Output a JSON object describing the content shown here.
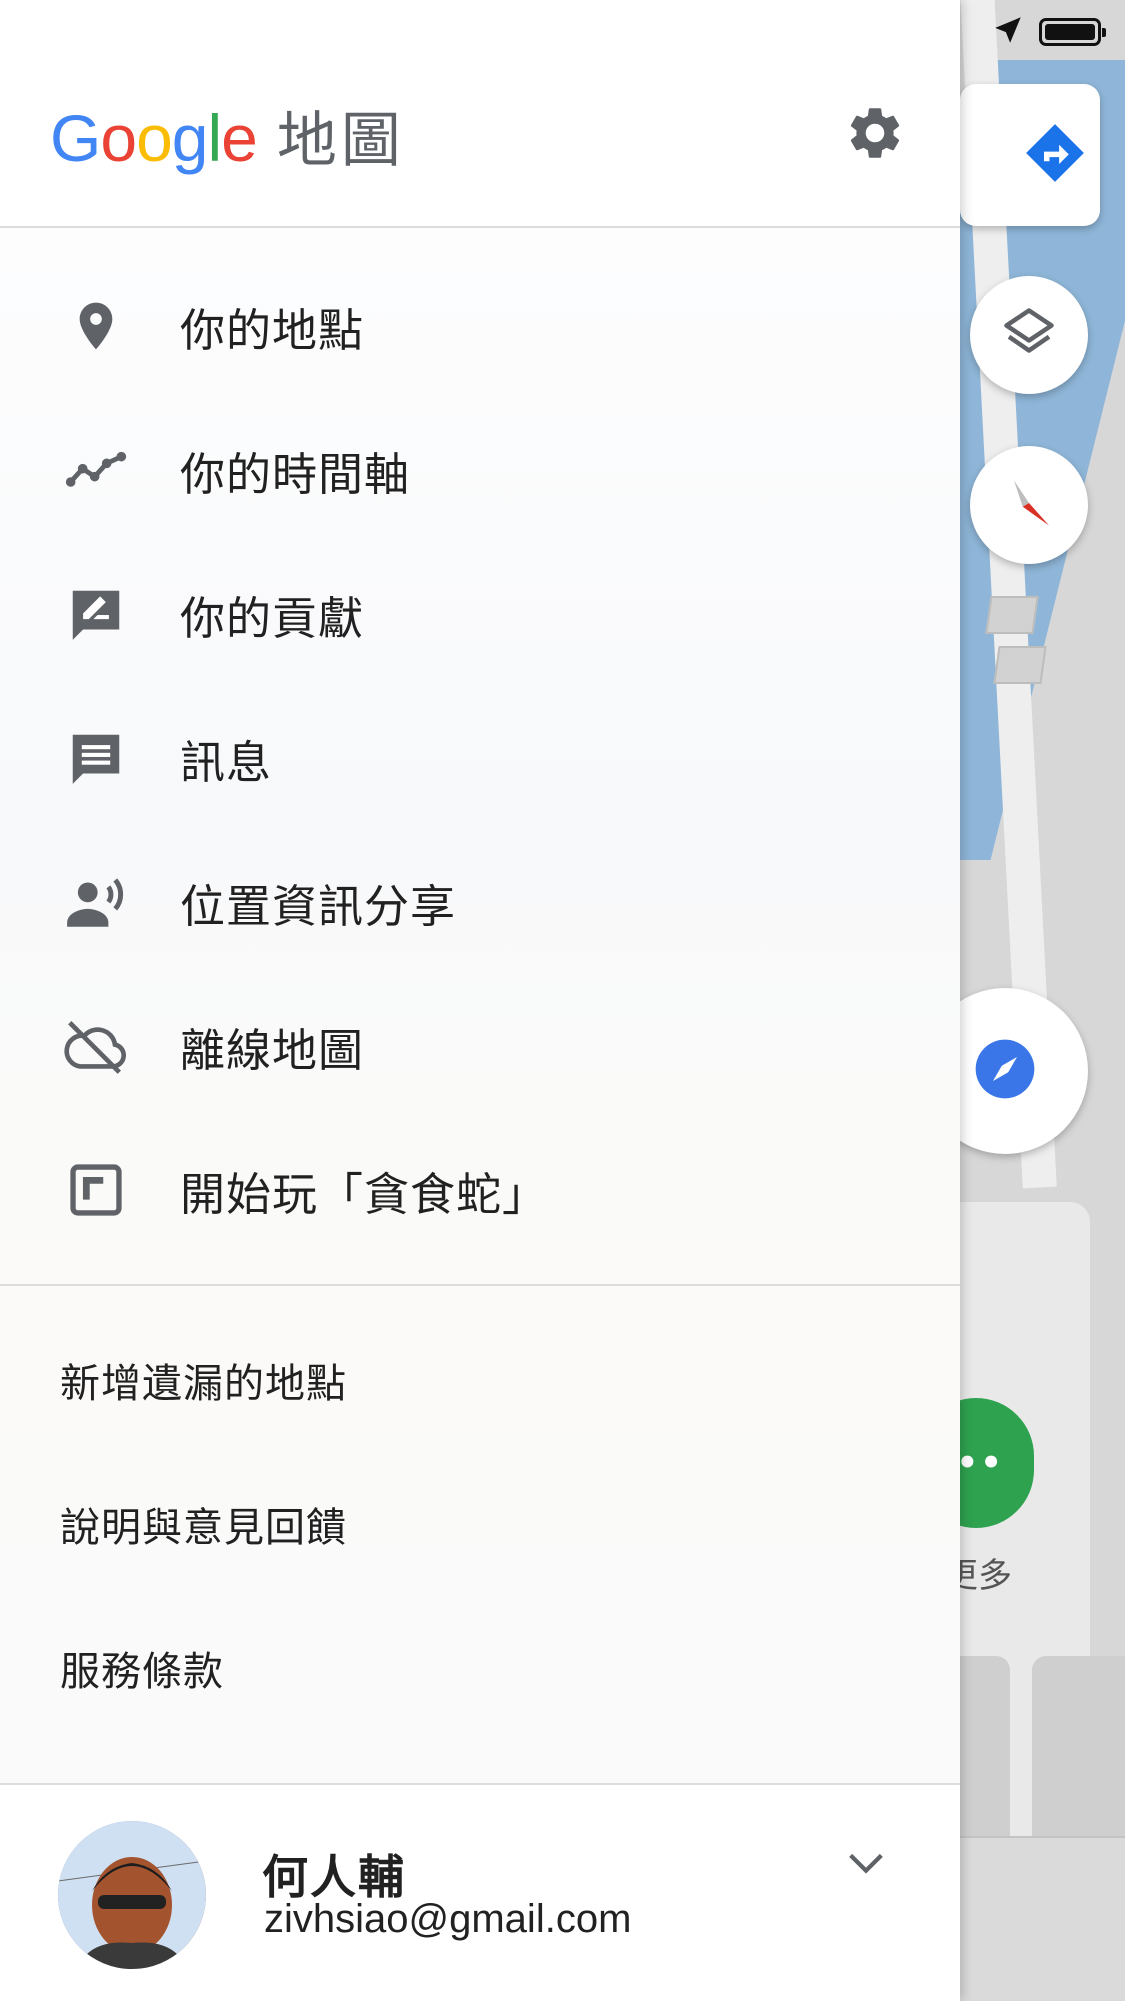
{
  "app": {
    "logo_letters": [
      {
        "char": "G",
        "color": "#4285F4"
      },
      {
        "char": "o",
        "color": "#EA4335"
      },
      {
        "char": "o",
        "color": "#FBBC05"
      },
      {
        "char": "g",
        "color": "#4285F4"
      },
      {
        "char": "l",
        "color": "#34A853"
      },
      {
        "char": "e",
        "color": "#EA4335"
      }
    ],
    "logo_text": "Google",
    "logo_suffix": "地圖"
  },
  "header": {
    "settings_icon": "gear-icon"
  },
  "menu_primary": [
    {
      "label": "你的地點",
      "icon": "location-pin-icon"
    },
    {
      "label": "你的時間軸",
      "icon": "timeline-icon"
    },
    {
      "label": "你的貢獻",
      "icon": "contribute-icon"
    },
    {
      "label": "訊息",
      "icon": "message-icon"
    },
    {
      "label": "位置資訊分享",
      "icon": "location-sharing-icon"
    },
    {
      "label": "離線地圖",
      "icon": "cloud-off-icon"
    },
    {
      "label": "開始玩「貪食蛇」",
      "icon": "snake-game-icon"
    }
  ],
  "menu_secondary": [
    {
      "label": "新增遺漏的地點"
    },
    {
      "label": "說明與意見回饋"
    },
    {
      "label": "服務條款"
    }
  ],
  "account": {
    "name": "何人輔",
    "email": "zivhsiao@gmail.com"
  },
  "map": {
    "more_label": "更多"
  },
  "colors": {
    "icon_gray": "#5f6368",
    "directions_blue": "#1a73e8",
    "compass_red": "#d93025",
    "explore_green": "#2ea24f"
  }
}
